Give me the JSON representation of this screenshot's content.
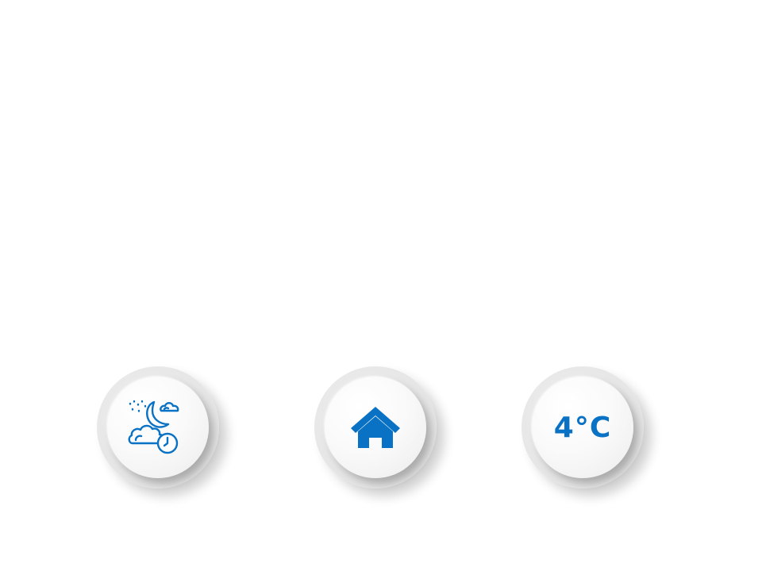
{
  "accent_color": "#0a72c4",
  "buttons": [
    {
      "name": "night-weather-schedule",
      "icon": "night-cloud-clock-icon"
    },
    {
      "name": "home",
      "icon": "home-icon"
    },
    {
      "name": "temperature",
      "label": "4°C"
    }
  ]
}
